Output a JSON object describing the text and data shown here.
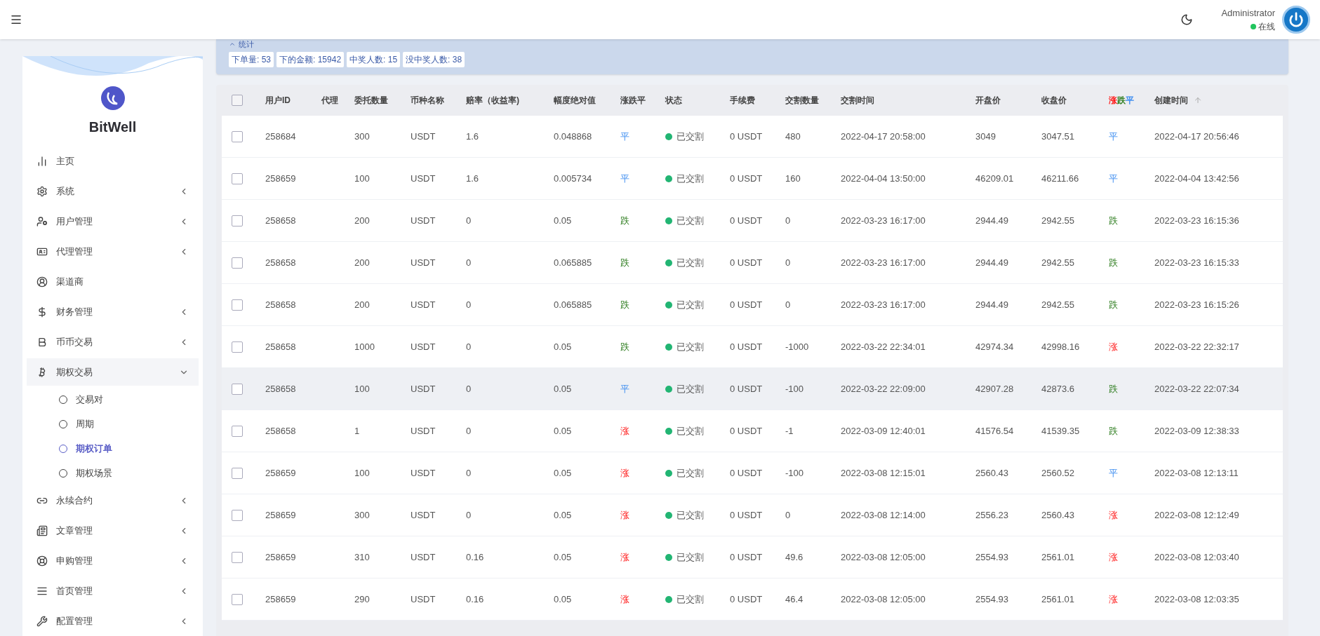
{
  "header": {
    "user_name": "Administrator",
    "status_text": "在线"
  },
  "sidebar": {
    "brand": "BitWell",
    "items": [
      {
        "label": "主页",
        "kind": "link"
      },
      {
        "label": "系统",
        "kind": "group",
        "expanded": false
      },
      {
        "label": "用户管理",
        "kind": "group",
        "expanded": false
      },
      {
        "label": "代理管理",
        "kind": "group",
        "expanded": false
      },
      {
        "label": "渠道商",
        "kind": "link"
      },
      {
        "label": "财务管理",
        "kind": "group",
        "expanded": false
      },
      {
        "label": "币币交易",
        "kind": "group",
        "expanded": false
      },
      {
        "label": "期权交易",
        "kind": "group",
        "expanded": true,
        "children": [
          {
            "label": "交易对",
            "selected": false
          },
          {
            "label": "周期",
            "selected": false
          },
          {
            "label": "期权订单",
            "selected": true
          },
          {
            "label": "期权场景",
            "selected": false
          }
        ]
      },
      {
        "label": "永续合约",
        "kind": "group",
        "expanded": false
      },
      {
        "label": "文章管理",
        "kind": "group",
        "expanded": false
      },
      {
        "label": "申购管理",
        "kind": "group",
        "expanded": false
      },
      {
        "label": "首页管理",
        "kind": "group",
        "expanded": false
      },
      {
        "label": "配置管理",
        "kind": "group",
        "expanded": false
      }
    ]
  },
  "stats": {
    "title": "统计",
    "expanded": true,
    "badges": [
      "下单量: 53",
      "下的金额: 15942",
      "中奖人数: 15",
      "没中奖人数: 38"
    ]
  },
  "table": {
    "columns": [
      {
        "label": "用户ID"
      },
      {
        "label": "代理"
      },
      {
        "label": "委托数量"
      },
      {
        "label": "币种名称"
      },
      {
        "label": "赔率（收益率)"
      },
      {
        "label": "幅度绝对值"
      },
      {
        "label": "涨跌平"
      },
      {
        "label": "状态"
      },
      {
        "label": "手续费"
      },
      {
        "label": "交割数量"
      },
      {
        "label": "交割时间"
      },
      {
        "label": "开盘价"
      },
      {
        "label": "收盘价"
      },
      {
        "parts": [
          {
            "text": "涨",
            "kind": "up"
          },
          {
            "text": "跌",
            "kind": "down"
          },
          {
            "text": "平",
            "kind": "flat"
          }
        ]
      },
      {
        "label": "创建时间",
        "sorted": true
      }
    ],
    "all_checked": false,
    "rows": [
      {
        "checked": false,
        "hovered": false,
        "user_id": "258684",
        "amount": "300",
        "currency": "USDT",
        "odds": "1.6",
        "amplitude": "0.048868",
        "trend": {
          "text": "平",
          "kind": "flat"
        },
        "status": {
          "text": "已交割",
          "color": "#22b573"
        },
        "fee": "0 USDT",
        "settle_qty": "480",
        "settle_time": "2022-04-17 20:58:00",
        "open": "3049",
        "close": "3047.51",
        "result": {
          "text": "平",
          "kind": "flat"
        },
        "created": "2022-04-17 20:56:46"
      },
      {
        "checked": false,
        "hovered": false,
        "user_id": "258659",
        "amount": "100",
        "currency": "USDT",
        "odds": "1.6",
        "amplitude": "0.005734",
        "trend": {
          "text": "平",
          "kind": "flat"
        },
        "status": {
          "text": "已交割",
          "color": "#22b573"
        },
        "fee": "0 USDT",
        "settle_qty": "160",
        "settle_time": "2022-04-04 13:50:00",
        "open": "46209.01",
        "close": "46211.66",
        "result": {
          "text": "平",
          "kind": "flat"
        },
        "created": "2022-04-04 13:42:56"
      },
      {
        "checked": false,
        "hovered": false,
        "user_id": "258658",
        "amount": "200",
        "currency": "USDT",
        "odds": "0",
        "amplitude": "0.05",
        "trend": {
          "text": "跌",
          "kind": "down"
        },
        "status": {
          "text": "已交割",
          "color": "#22b573"
        },
        "fee": "0 USDT",
        "settle_qty": "0",
        "settle_time": "2022-03-23 16:17:00",
        "open": "2944.49",
        "close": "2942.55",
        "result": {
          "text": "跌",
          "kind": "down"
        },
        "created": "2022-03-23 16:15:36"
      },
      {
        "checked": false,
        "hovered": false,
        "user_id": "258658",
        "amount": "200",
        "currency": "USDT",
        "odds": "0",
        "amplitude": "0.065885",
        "trend": {
          "text": "跌",
          "kind": "down"
        },
        "status": {
          "text": "已交割",
          "color": "#22b573"
        },
        "fee": "0 USDT",
        "settle_qty": "0",
        "settle_time": "2022-03-23 16:17:00",
        "open": "2944.49",
        "close": "2942.55",
        "result": {
          "text": "跌",
          "kind": "down"
        },
        "created": "2022-03-23 16:15:33"
      },
      {
        "checked": false,
        "hovered": false,
        "user_id": "258658",
        "amount": "200",
        "currency": "USDT",
        "odds": "0",
        "amplitude": "0.065885",
        "trend": {
          "text": "跌",
          "kind": "down"
        },
        "status": {
          "text": "已交割",
          "color": "#22b573"
        },
        "fee": "0 USDT",
        "settle_qty": "0",
        "settle_time": "2022-03-23 16:17:00",
        "open": "2944.49",
        "close": "2942.55",
        "result": {
          "text": "跌",
          "kind": "down"
        },
        "created": "2022-03-23 16:15:26"
      },
      {
        "checked": false,
        "hovered": false,
        "user_id": "258658",
        "amount": "1000",
        "currency": "USDT",
        "odds": "0",
        "amplitude": "0.05",
        "trend": {
          "text": "跌",
          "kind": "down"
        },
        "status": {
          "text": "已交割",
          "color": "#22b573"
        },
        "fee": "0 USDT",
        "settle_qty": "-1000",
        "settle_time": "2022-03-22 22:34:01",
        "open": "42974.34",
        "close": "42998.16",
        "result": {
          "text": "涨",
          "kind": "up"
        },
        "created": "2022-03-22 22:32:17"
      },
      {
        "checked": false,
        "hovered": true,
        "user_id": "258658",
        "amount": "100",
        "currency": "USDT",
        "odds": "0",
        "amplitude": "0.05",
        "trend": {
          "text": "平",
          "kind": "flat"
        },
        "status": {
          "text": "已交割",
          "color": "#22b573"
        },
        "fee": "0 USDT",
        "settle_qty": "-100",
        "settle_time": "2022-03-22 22:09:00",
        "open": "42907.28",
        "close": "42873.6",
        "result": {
          "text": "跌",
          "kind": "down"
        },
        "created": "2022-03-22 22:07:34"
      },
      {
        "checked": false,
        "hovered": false,
        "user_id": "258658",
        "amount": "1",
        "currency": "USDT",
        "odds": "0",
        "amplitude": "0.05",
        "trend": {
          "text": "涨",
          "kind": "up"
        },
        "status": {
          "text": "已交割",
          "color": "#22b573"
        },
        "fee": "0 USDT",
        "settle_qty": "-1",
        "settle_time": "2022-03-09 12:40:01",
        "open": "41576.54",
        "close": "41539.35",
        "result": {
          "text": "跌",
          "kind": "down"
        },
        "created": "2022-03-09 12:38:33"
      },
      {
        "checked": false,
        "hovered": false,
        "user_id": "258659",
        "amount": "100",
        "currency": "USDT",
        "odds": "0",
        "amplitude": "0.05",
        "trend": {
          "text": "涨",
          "kind": "up"
        },
        "status": {
          "text": "已交割",
          "color": "#22b573"
        },
        "fee": "0 USDT",
        "settle_qty": "-100",
        "settle_time": "2022-03-08 12:15:01",
        "open": "2560.43",
        "close": "2560.52",
        "result": {
          "text": "平",
          "kind": "flat"
        },
        "created": "2022-03-08 12:13:11"
      },
      {
        "checked": false,
        "hovered": false,
        "user_id": "258659",
        "amount": "300",
        "currency": "USDT",
        "odds": "0",
        "amplitude": "0.05",
        "trend": {
          "text": "涨",
          "kind": "up"
        },
        "status": {
          "text": "已交割",
          "color": "#22b573"
        },
        "fee": "0 USDT",
        "settle_qty": "0",
        "settle_time": "2022-03-08 12:14:00",
        "open": "2556.23",
        "close": "2560.43",
        "result": {
          "text": "涨",
          "kind": "up"
        },
        "created": "2022-03-08 12:12:49"
      },
      {
        "checked": false,
        "hovered": false,
        "user_id": "258659",
        "amount": "310",
        "currency": "USDT",
        "odds": "0.16",
        "amplitude": "0.05",
        "trend": {
          "text": "涨",
          "kind": "up"
        },
        "status": {
          "text": "已交割",
          "color": "#22b573"
        },
        "fee": "0 USDT",
        "settle_qty": "49.6",
        "settle_time": "2022-03-08 12:05:00",
        "open": "2554.93",
        "close": "2561.01",
        "result": {
          "text": "涨",
          "kind": "up"
        },
        "created": "2022-03-08 12:03:40"
      },
      {
        "checked": false,
        "hovered": false,
        "user_id": "258659",
        "amount": "290",
        "currency": "USDT",
        "odds": "0.16",
        "amplitude": "0.05",
        "trend": {
          "text": "涨",
          "kind": "up"
        },
        "status": {
          "text": "已交割",
          "color": "#22b573"
        },
        "fee": "0 USDT",
        "settle_qty": "46.4",
        "settle_time": "2022-03-08 12:05:00",
        "open": "2554.93",
        "close": "2561.01",
        "result": {
          "text": "涨",
          "kind": "up"
        },
        "created": "2022-03-08 12:03:35"
      }
    ]
  }
}
